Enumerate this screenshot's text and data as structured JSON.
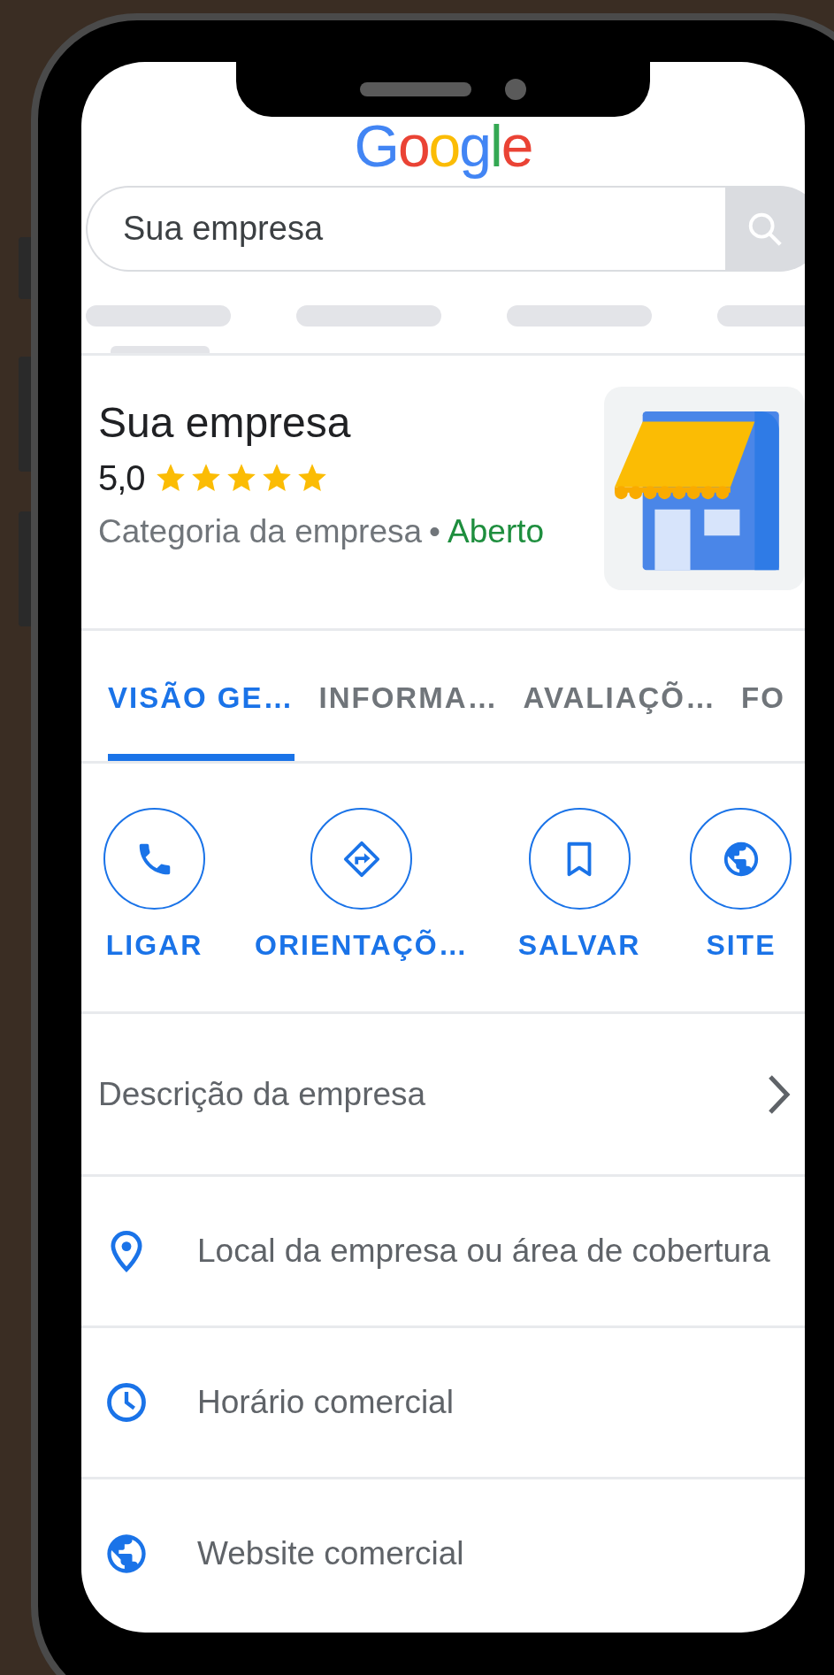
{
  "logo": "Google",
  "search": {
    "value": "Sua empresa"
  },
  "business": {
    "name": "Sua empresa",
    "rating": "5,0",
    "stars": 5,
    "category": "Categoria da empresa",
    "separator": "•",
    "status": "Aberto"
  },
  "tabs": [
    {
      "label": "VISÃO GE…",
      "selected": true
    },
    {
      "label": "INFORMA…",
      "selected": false
    },
    {
      "label": "AVALIAÇÕ…",
      "selected": false
    },
    {
      "label": "FO",
      "selected": false
    }
  ],
  "actions": [
    {
      "kind": "call",
      "label": "LIGAR"
    },
    {
      "kind": "directions",
      "label": "ORIENTAÇÕ…"
    },
    {
      "kind": "save",
      "label": "SALVAR"
    },
    {
      "kind": "site",
      "label": "SITE"
    }
  ],
  "rows": [
    {
      "kind": "description",
      "label": "Descrição da empresa"
    },
    {
      "kind": "location",
      "label": "Local da empresa ou área de cobertura"
    },
    {
      "kind": "hours",
      "label": "Horário comercial"
    },
    {
      "kind": "website",
      "label": "Website comercial"
    }
  ]
}
